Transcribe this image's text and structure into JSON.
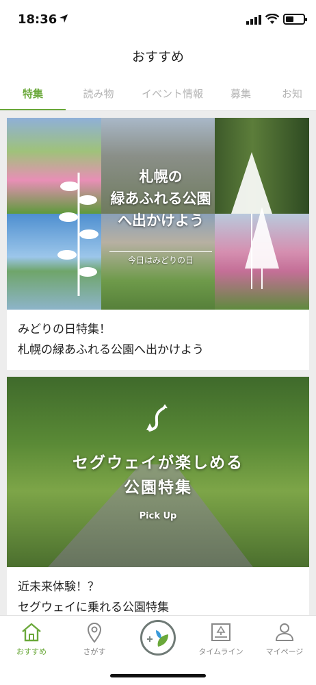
{
  "status_bar": {
    "time": "18:36",
    "battery_level": 0.45
  },
  "nav": {
    "title": "おすすめ"
  },
  "tabs": [
    {
      "label": "特集",
      "active": true
    },
    {
      "label": "読み物",
      "active": false
    },
    {
      "label": "イベント情報",
      "active": false
    },
    {
      "label": "募集",
      "active": false
    },
    {
      "label": "お知",
      "active": false
    }
  ],
  "feed": {
    "cards": [
      {
        "image_overlay": {
          "title_line1": "札幌の",
          "title_line2": "緑あふれる公園",
          "title_line3": "へ出かけよう",
          "subtitle": "今日はみどりの日"
        },
        "text_line1": "みどりの日特集！",
        "text_line2": "札幌の緑あふれる公園へ出かけよう"
      },
      {
        "image_overlay": {
          "title_line1": "セグウェイが楽しめる",
          "title_line2": "公園特集",
          "pick_up": "Pick Up"
        },
        "text_line1": "近未来体験！？",
        "text_line2": "セグウェイに乗れる公園特集"
      }
    ]
  },
  "bottom_bar": {
    "items": [
      {
        "label": "おすすめ",
        "icon": "home-icon",
        "active": true
      },
      {
        "label": "さがす",
        "icon": "location-pin-icon",
        "active": false
      },
      {
        "label": "",
        "icon": "plus-leaf-icon",
        "active": false
      },
      {
        "label": "タイムライン",
        "icon": "timeline-icon",
        "active": false
      },
      {
        "label": "マイページ",
        "icon": "user-icon",
        "active": false
      }
    ]
  },
  "colors": {
    "accent": "#6aa83a",
    "inactive_tab": "#b5b5b5",
    "feed_background": "#ededed"
  }
}
